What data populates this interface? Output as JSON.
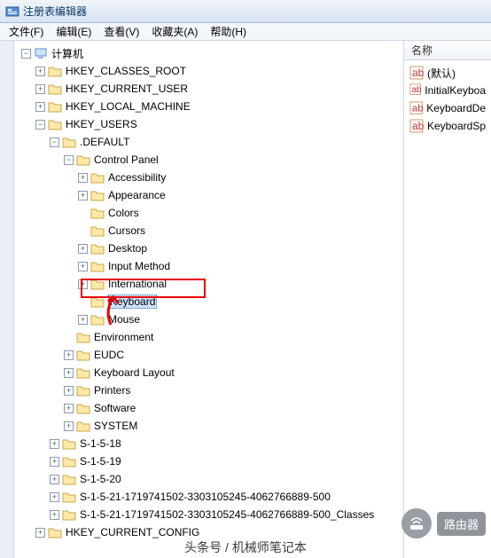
{
  "window": {
    "title": "注册表编辑器"
  },
  "menu": {
    "file": "文件(F)",
    "edit": "编辑(E)",
    "view": "查看(V)",
    "favorites": "收藏夹(A)",
    "help": "帮助(H)"
  },
  "right_header": "名称",
  "tree": {
    "root": "计算机",
    "hkcr": "HKEY_CLASSES_ROOT",
    "hkcu": "HKEY_CURRENT_USER",
    "hklm": "HKEY_LOCAL_MACHINE",
    "hku": "HKEY_USERS",
    "default": ".DEFAULT",
    "cpanel": "Control Panel",
    "cp": {
      "accessibility": "Accessibility",
      "appearance": "Appearance",
      "colors": "Colors",
      "cursors": "Cursors",
      "desktop": "Desktop",
      "input_method": "Input Method",
      "international": "International",
      "keyboard": "Keyboard",
      "mouse": "Mouse"
    },
    "env": "Environment",
    "eudc": "EUDC",
    "kbd_layout": "Keyboard Layout",
    "printers": "Printers",
    "software": "Software",
    "system": "SYSTEM",
    "s18": "S-1-5-18",
    "s19": "S-1-5-19",
    "s20": "S-1-5-20",
    "sid1": "S-1-5-21-1719741502-3303105245-4062766889-500",
    "sid2": "S-1-5-21-1719741502-3303105245-4062766889-500_Classes",
    "hkcc": "HKEY_CURRENT_CONFIG"
  },
  "values": {
    "default": "(默认)",
    "v1": "InitialKeyboa",
    "v2": "KeyboardDe",
    "v3": "KeyboardSp"
  },
  "watermark": {
    "badge": "路由器",
    "footer": "头条号 / 机械师笔记本"
  }
}
